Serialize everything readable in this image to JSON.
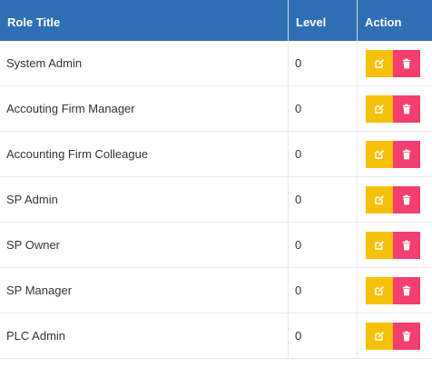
{
  "table": {
    "headers": {
      "role_title": "Role Title",
      "level": "Level",
      "action": "Action"
    },
    "rows": [
      {
        "role_title": "System Admin",
        "level": "0"
      },
      {
        "role_title": "Accouting Firm Manager",
        "level": "0"
      },
      {
        "role_title": "Accounting Firm Colleague",
        "level": "0"
      },
      {
        "role_title": "SP Admin",
        "level": "0"
      },
      {
        "role_title": "SP Owner",
        "level": "0"
      },
      {
        "role_title": "SP Manager",
        "level": "0"
      },
      {
        "role_title": "PLC Admin",
        "level": "0"
      }
    ]
  },
  "icons": {
    "edit": "edit-icon",
    "delete": "trash-icon"
  },
  "colors": {
    "header_bg": "#2f6fb5",
    "edit_button": "#f8c109",
    "delete_button": "#f23f6f"
  }
}
